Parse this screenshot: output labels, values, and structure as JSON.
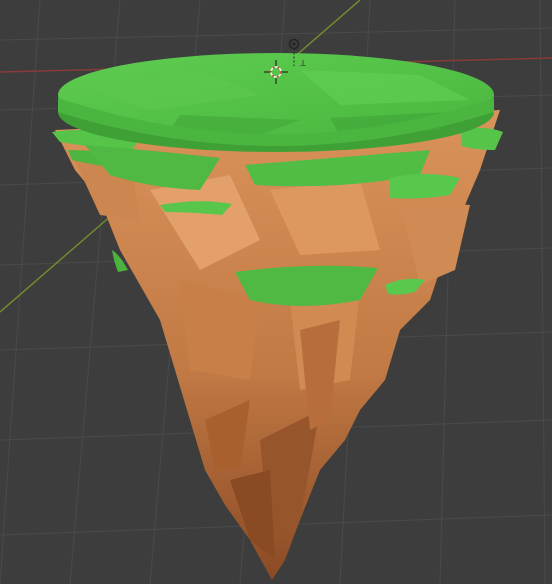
{
  "viewport": {
    "background_color": "#3d3d3d",
    "grid_color": "#4a4a4a",
    "x_axis_color": "#8a3a3a",
    "y_axis_color": "#6f8a2e"
  },
  "object": {
    "type": "low-poly floating island mesh",
    "grass_colors": [
      "#57c64a",
      "#4bb63f",
      "#3fa036",
      "#6bd35b"
    ],
    "rock_colors": [
      "#d48c52",
      "#c27a45",
      "#a8602f",
      "#8a4a24",
      "#e3a06a"
    ]
  },
  "icons": {
    "light": "light-icon",
    "camera": "camera-icon",
    "cursor": "3d-cursor-icon"
  }
}
